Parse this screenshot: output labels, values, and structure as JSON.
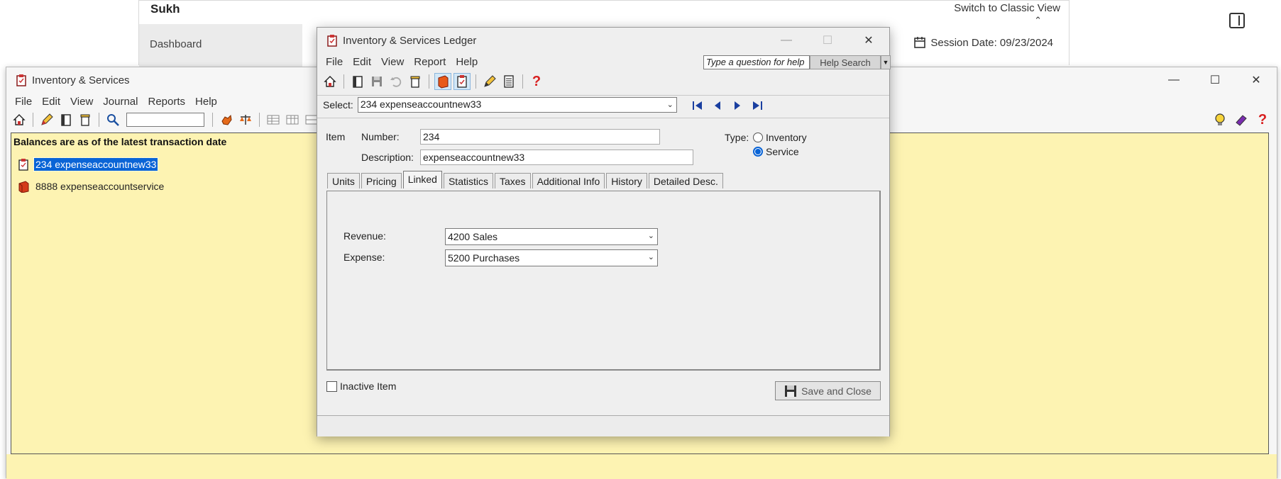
{
  "background_app": {
    "company": "Sukh",
    "classic_view": "Switch to Classic View",
    "dashboard": "Dashboard",
    "session_date": "Session Date: 09/23/2024"
  },
  "inventory_window": {
    "title": "Inventory & Services",
    "menu": [
      "File",
      "Edit",
      "View",
      "Journal",
      "Reports",
      "Help"
    ],
    "search_value": "",
    "panel_header": "Balances are as of the latest transaction date",
    "items": [
      {
        "label": "234 expenseaccountnew33",
        "selected": true
      },
      {
        "label": "8888 expenseaccountservice",
        "selected": false
      }
    ]
  },
  "ledger": {
    "title": "Inventory & Services Ledger",
    "menu": [
      "File",
      "Edit",
      "View",
      "Report",
      "Help"
    ],
    "help_placeholder": "Type a question for help",
    "help_search": "Help Search",
    "select_label": "Select:",
    "select_value": "234  expenseaccountnew33",
    "item_label": "Item",
    "number_label": "Number:",
    "number_value": "234",
    "description_label": "Description:",
    "description_value": "expenseaccountnew33",
    "type_label": "Type:",
    "type_options": [
      "Inventory",
      "Service"
    ],
    "type_selected": "Service",
    "tabs": [
      "Units",
      "Pricing",
      "Linked",
      "Statistics",
      "Taxes",
      "Additional Info",
      "History",
      "Detailed Desc."
    ],
    "active_tab": "Linked",
    "revenue_label": "Revenue:",
    "revenue_value": "4200 Sales",
    "expense_label": "Expense:",
    "expense_value": "5200 Purchases",
    "inactive_label": "Inactive Item",
    "save_close": "Save and Close"
  },
  "colors": {
    "panel_yellow": "#fdf3b2",
    "selection_blue": "#0a64d6"
  },
  "icons": [
    "home-icon",
    "edit-icon",
    "book-icon",
    "bin-icon",
    "search-icon",
    "balance-icon",
    "save-icon",
    "undo-icon",
    "red-book-icon",
    "clipboard-icon",
    "pencil-icon",
    "calculator-icon",
    "help-icon",
    "lightbulb-icon",
    "first-icon",
    "prev-icon",
    "next-icon",
    "last-icon"
  ]
}
